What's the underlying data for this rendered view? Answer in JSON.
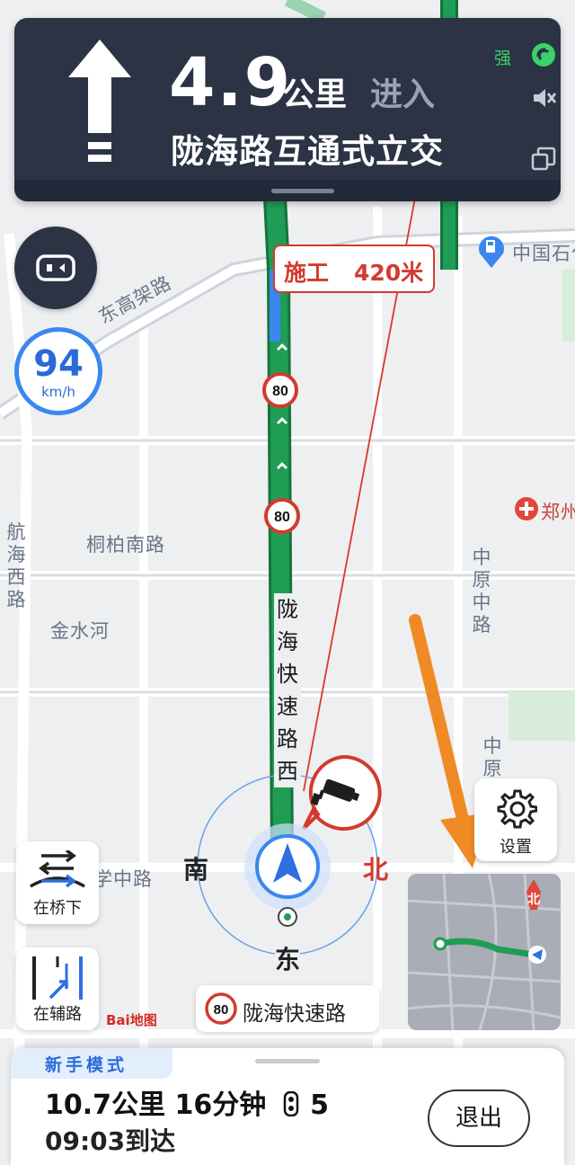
{
  "guidance": {
    "distance": "4.9",
    "unit": "公里",
    "action": "进入",
    "road_name": "陇海路互通式立交",
    "signal_label": "强"
  },
  "speed": {
    "value": "94",
    "unit": "km/h"
  },
  "map_labels": {
    "high_road": "东高架路",
    "tongbai": "桐柏南路",
    "jinshui": "金水河",
    "hanghai": "航海西路",
    "zhongyuan": "中原中路",
    "zhongyuan2": "中原",
    "xue": "学中路",
    "longhai_vertical": "陇海快速路西",
    "sinopec": "中国石化",
    "zheng": "郑州"
  },
  "speed_limits": [
    "80",
    "80"
  ],
  "construction": {
    "label": "施工",
    "distance": "420米"
  },
  "compass": {
    "south": "南",
    "north": "北",
    "east": "东"
  },
  "controls": {
    "under_bridge": "在桥下",
    "side_road": "在辅路",
    "settings": "设置",
    "minimap_north": "北"
  },
  "current_road": {
    "limit": "80",
    "name": "陇海快速路"
  },
  "bottom": {
    "mode": "新手模式",
    "trip": "10.7公里 16分钟",
    "lights": "5",
    "arrival": "09:03到达",
    "exit": "退出"
  },
  "watermark": "Bai地图",
  "colors": {
    "panel": "#2b3344",
    "route_green": "#1f9d55",
    "accent_blue": "#3a87f0",
    "warning_red": "#d23a2f",
    "annotation_orange": "#f08a24"
  }
}
